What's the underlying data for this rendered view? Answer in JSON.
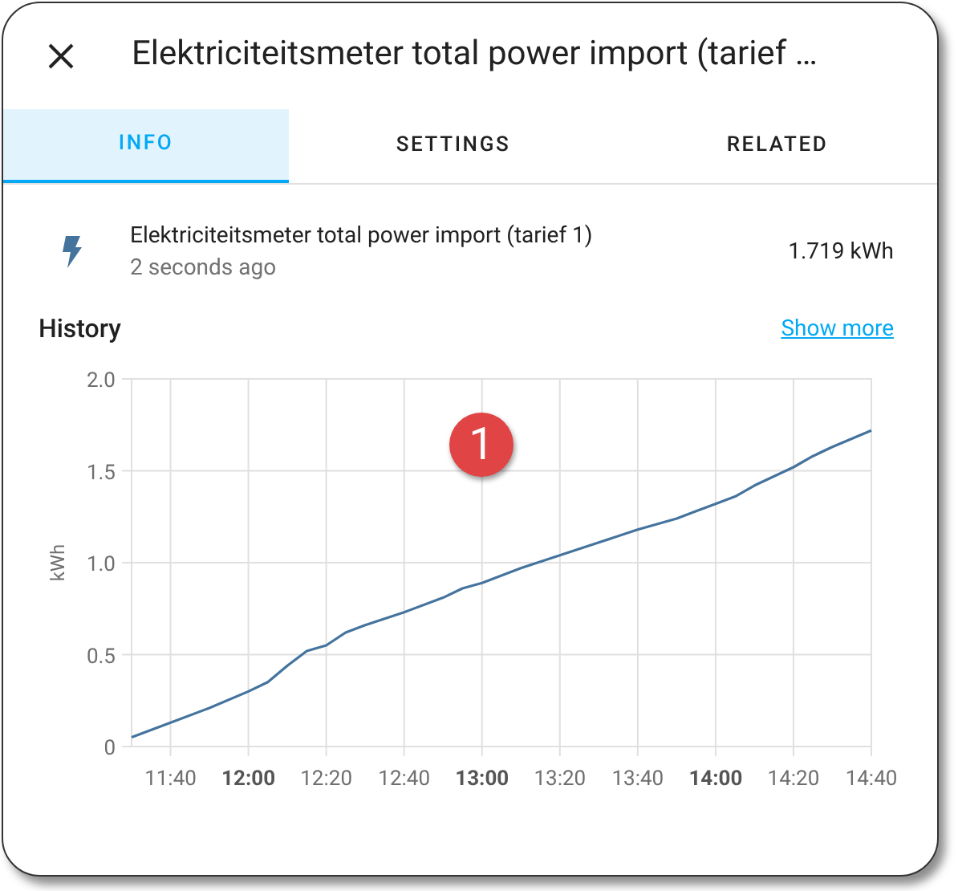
{
  "dialog": {
    "title": "Elektriciteitsmeter total power import (tarief …"
  },
  "tabs": [
    {
      "label": "INFO",
      "selected": true
    },
    {
      "label": "SETTINGS",
      "selected": false
    },
    {
      "label": "RELATED",
      "selected": false
    }
  ],
  "entity": {
    "name": "Elektriciteitsmeter total power import (tarief 1)",
    "last_changed": "2 seconds ago",
    "state": "1.719 kWh"
  },
  "history": {
    "title": "History",
    "link": "Show more",
    "chart_data": {
      "type": "line",
      "ylabel": "kWh",
      "x": [
        690,
        700,
        710,
        720,
        725,
        730,
        735,
        740,
        745,
        750,
        760,
        770,
        775,
        780,
        790,
        800,
        810,
        820,
        830,
        835,
        840,
        845,
        850,
        860,
        865,
        870,
        880
      ],
      "grid": true,
      "series": [
        {
          "color": "#44739e",
          "values": [
            0.05,
            0.13,
            0.21,
            0.3,
            0.35,
            0.44,
            0.52,
            0.55,
            0.62,
            0.66,
            0.73,
            0.81,
            0.86,
            0.89,
            0.97,
            1.04,
            1.11,
            1.18,
            1.24,
            1.28,
            1.32,
            1.36,
            1.42,
            1.52,
            1.58,
            1.63,
            1.72
          ]
        }
      ],
      "xlim": [
        690,
        880
      ],
      "ylim": [
        0,
        2
      ],
      "xticks": [
        {
          "value": 700,
          "label": "11:40"
        },
        {
          "value": 720,
          "label": "12:00"
        },
        {
          "value": 740,
          "label": "12:20"
        },
        {
          "value": 760,
          "label": "12:40"
        },
        {
          "value": 780,
          "label": "13:00"
        },
        {
          "value": 800,
          "label": "13:20"
        },
        {
          "value": 820,
          "label": "13:40"
        },
        {
          "value": 840,
          "label": "14:00"
        },
        {
          "value": 860,
          "label": "14:20"
        },
        {
          "value": 880,
          "label": "14:40"
        }
      ],
      "yticks": [
        {
          "value": 0,
          "label": "0"
        },
        {
          "value": 0.5,
          "label": "0.5"
        },
        {
          "value": 1,
          "label": "1.0"
        },
        {
          "value": 1.5,
          "label": "1.5"
        },
        {
          "value": 2,
          "label": "2.0"
        }
      ]
    }
  },
  "callout": {
    "label": "1"
  }
}
